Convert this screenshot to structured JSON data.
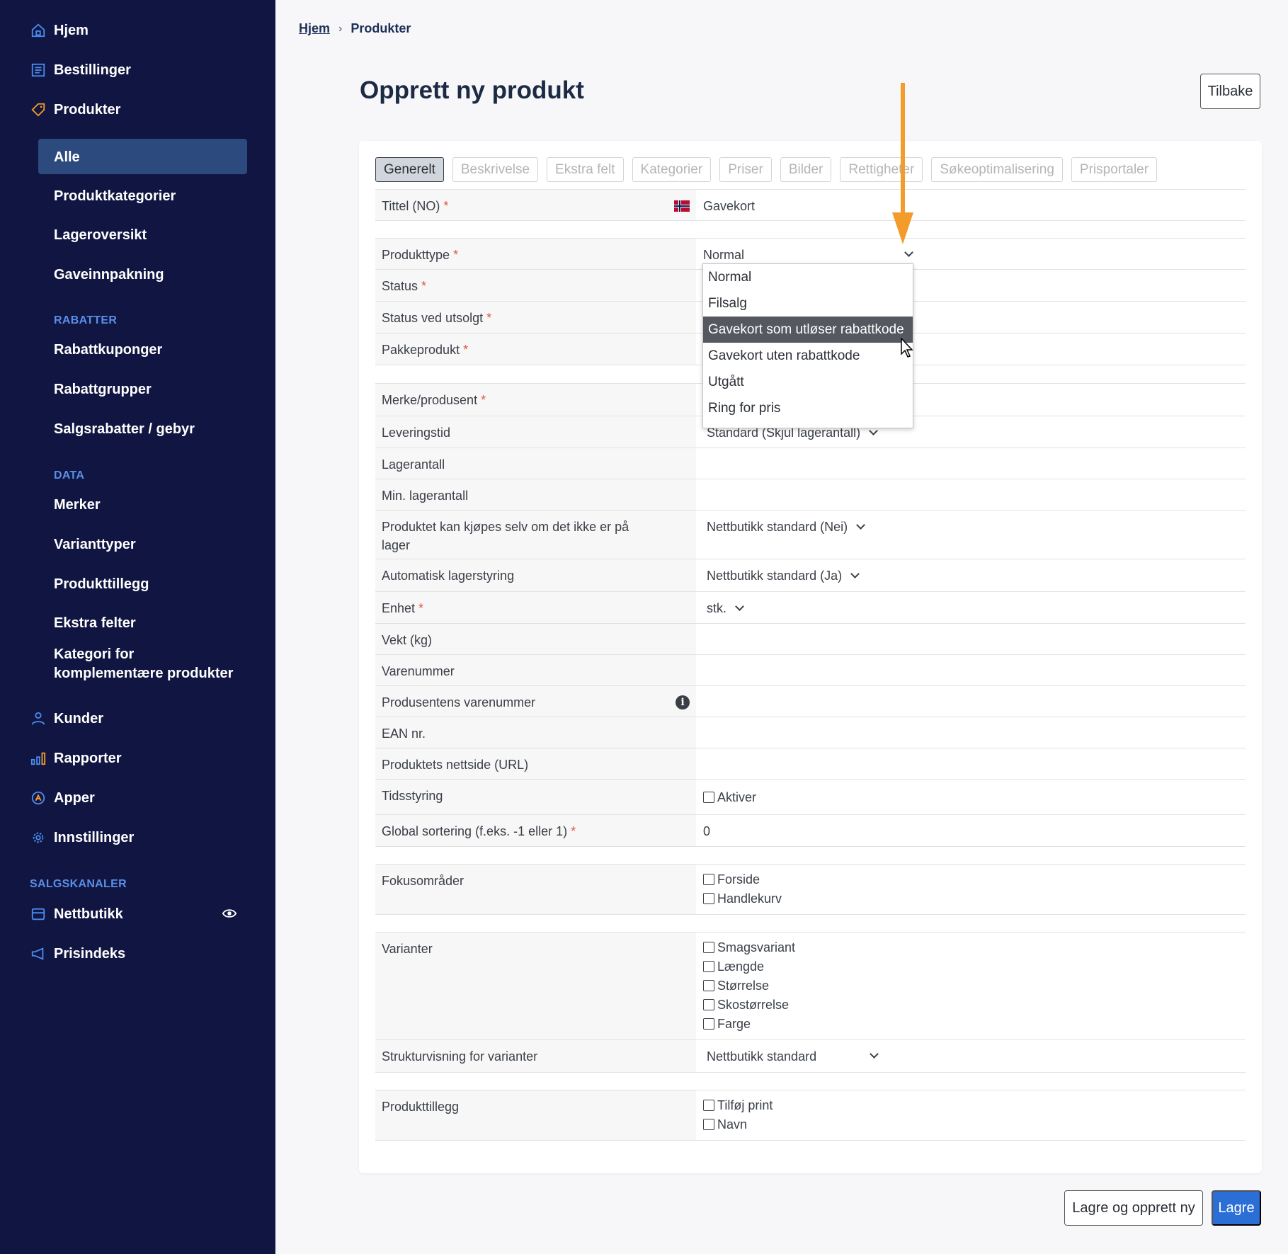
{
  "sidebar": {
    "main": [
      {
        "label": "Hjem",
        "icon": "home-icon"
      },
      {
        "label": "Bestillinger",
        "icon": "orders-icon"
      },
      {
        "label": "Produkter",
        "icon": "tag-icon"
      }
    ],
    "products_sub": [
      "Alle",
      "Produktkategorier",
      "Lageroversikt",
      "Gaveinnpakning"
    ],
    "section_rabatter": "RABATTER",
    "rabatter": [
      "Rabattkuponger",
      "Rabattgrupper",
      "Salgsrabatter / gebyr"
    ],
    "section_data": "DATA",
    "data": [
      "Merker",
      "Varianttyper",
      "Produkttillegg",
      "Ekstra felter",
      "Kategori for komplementære produkter"
    ],
    "bottom": [
      {
        "label": "Kunder",
        "icon": "user-icon"
      },
      {
        "label": "Rapporter",
        "icon": "chart-icon"
      },
      {
        "label": "Apper",
        "icon": "apps-icon"
      },
      {
        "label": "Innstillinger",
        "icon": "gear-icon"
      }
    ],
    "section_salgskanaler": "SALGSKANALER",
    "channels": [
      {
        "label": "Nettbutikk",
        "icon": "store-icon"
      },
      {
        "label": "Prisindeks",
        "icon": "megaphone-icon"
      }
    ]
  },
  "breadcrumb": {
    "home": "Hjem",
    "current": "Produkter"
  },
  "page": {
    "title": "Opprett ny produkt",
    "back_label": "Tilbake"
  },
  "tabs": [
    "Generelt",
    "Beskrivelse",
    "Ekstra felt",
    "Kategorier",
    "Priser",
    "Bilder",
    "Rettigheter",
    "Søkeoptimalisering",
    "Prisportaler"
  ],
  "form": {
    "title_label": "Tittel (NO)",
    "title_value": "Gavekort",
    "produkttype_label": "Produkttype",
    "produkttype_value": "Normal",
    "status_label": "Status",
    "status_utsolgt_label": "Status ved utsolgt",
    "pakkeprodukt_label": "Pakkeprodukt",
    "merke_label": "Merke/produsent",
    "leveringstid_label": "Leveringstid",
    "leveringstid_value": "Standard (Skjul lagerantall)",
    "lagerantall_label": "Lagerantall",
    "min_lager_label": "Min. lagerantall",
    "kjopes_label": "Produktet kan kjøpes selv om det ikke er på lager",
    "kjopes_value": "Nettbutikk standard (Nei)",
    "auto_lager_label": "Automatisk lagerstyring",
    "auto_lager_value": "Nettbutikk standard (Ja)",
    "enhet_label": "Enhet",
    "enhet_value": "stk.",
    "vekt_label": "Vekt (kg)",
    "varenummer_label": "Varenummer",
    "prod_varenummer_label": "Produsentens varenummer",
    "ean_label": "EAN nr.",
    "nettside_label": "Produktets nettside (URL)",
    "tidsstyring_label": "Tidsstyring",
    "tidsstyring_option": "Aktiver",
    "sortering_label": "Global sortering (f.eks. -1 eller 1)",
    "sortering_value": "0",
    "fokus_label": "Fokusområder",
    "fokus_options": [
      "Forside",
      "Handlekurv"
    ],
    "varianter_label": "Varianter",
    "varianter_options": [
      "Smagsvariant",
      "Længde",
      "Størrelse",
      "Skostørrelse",
      "Farge"
    ],
    "struktur_label": "Strukturvisning for varianter",
    "struktur_value": "Nettbutikk standard",
    "tillegg_label": "Produkttillegg",
    "tillegg_options": [
      "Tilføj print",
      "Navn"
    ],
    "required_mark": "*"
  },
  "dropdown": {
    "options": [
      "Normal",
      "Filsalg",
      "Gavekort som utløser rabattkode",
      "Gavekort uten rabattkode",
      "Utgått",
      "Ring for pris"
    ],
    "highlighted": "Gavekort som utløser rabattkode"
  },
  "actions": {
    "save_new": "Lagre og opprett ny",
    "save": "Lagre"
  },
  "colors": {
    "sidebar": "#111541",
    "active_nav": "#2c4a7e",
    "section": "#5a8fe8",
    "accent_orange": "#f39c2b",
    "primary": "#2b6fd6"
  }
}
